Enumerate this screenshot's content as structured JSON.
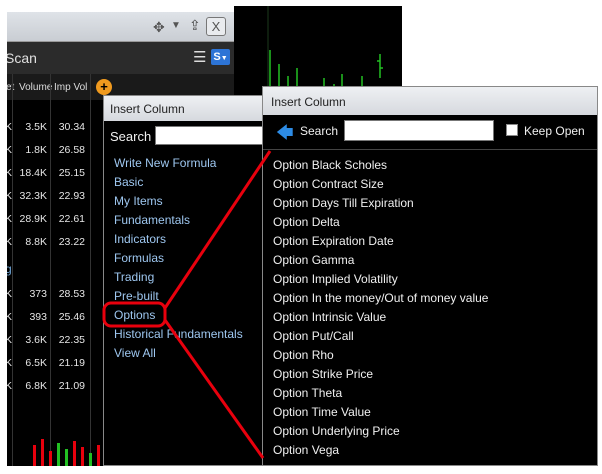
{
  "scan_window": {
    "title": "Scan",
    "columns": [
      "et",
      "Volume",
      "Imp Vol"
    ],
    "section_label": "g",
    "rows_top": [
      {
        "a": "K",
        "vol": "3.5K",
        "iv": "30.34"
      },
      {
        "a": "K",
        "vol": "1.8K",
        "iv": "26.58"
      },
      {
        "a": "K",
        "vol": "18.4K",
        "iv": "25.15"
      },
      {
        "a": "K",
        "vol": "32.3K",
        "iv": "22.93"
      },
      {
        "a": "K",
        "vol": "28.9K",
        "iv": "22.61"
      },
      {
        "a": "K",
        "vol": "8.8K",
        "iv": "23.22"
      }
    ],
    "rows_bottom": [
      {
        "a": "K",
        "vol": "373",
        "iv": "28.53"
      },
      {
        "a": "K",
        "vol": "393",
        "iv": "25.46"
      },
      {
        "a": "K",
        "vol": "3.6K",
        "iv": "22.35"
      },
      {
        "a": "K",
        "vol": "6.5K",
        "iv": "21.19"
      },
      {
        "a": "K",
        "vol": "6.8K",
        "iv": "21.09"
      }
    ],
    "s_button": "S",
    "close_label": "X",
    "add_label": "+"
  },
  "dialog_left": {
    "title": "Insert Column",
    "search_label": "Search",
    "search_value": "",
    "items": [
      "Write New Formula",
      "Basic",
      "My Items",
      "Fundamentals",
      "Indicators",
      "Formulas",
      "Trading",
      "Pre-built",
      "Options",
      "Historical Fundamentals",
      "View All"
    ],
    "highlighted_item": "Options"
  },
  "dialog_right": {
    "title": "Insert Column",
    "search_label": "Search",
    "search_value": "",
    "keep_open_label": "Keep Open",
    "keep_open_checked": false,
    "items": [
      "Option Black Scholes",
      "Option Contract Size",
      "Option Days Till Expiration",
      "Option Delta",
      "Option Expiration Date",
      "Option Gamma",
      "Option Implied Volatility",
      "Option In the money/Out of money value",
      "Option Intrinsic Value",
      "Option Put/Call",
      "Option Rho",
      "Option Strike Price",
      "Option Theta",
      "Option Time Value",
      "Option Underlying Price",
      "Option Vega"
    ]
  },
  "colors": {
    "annotation_red": "#e8000d",
    "link_blue": "#9ec7f0",
    "chart_green": "#22c022"
  }
}
